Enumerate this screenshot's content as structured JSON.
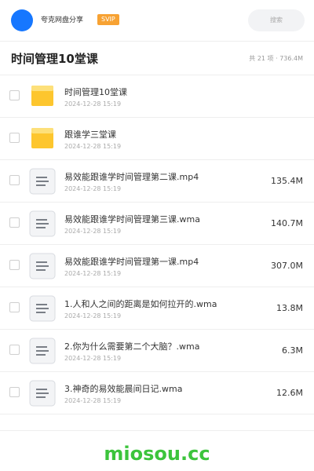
{
  "header": {
    "brand": "夸克网盘分享",
    "vip_badge": "SVIP",
    "search_placeholder": "搜索",
    "avatar_color": "#1677ff"
  },
  "title_bar": {
    "title": "时间管理10堂课",
    "summary": "共 21 项 · 736.4M"
  },
  "files": [
    {
      "name": "时间管理10堂课",
      "date": "2024-12-28 15:19",
      "size": "",
      "type": "folder",
      "icon": "folder-icon"
    },
    {
      "name": "跟谁学三堂课",
      "date": "2024-12-28 15:19",
      "size": "",
      "type": "folder",
      "icon": "folder-icon"
    },
    {
      "name": "易效能跟谁学时间管理第二课.mp4",
      "date": "2024-12-28 15:19",
      "size": "135.4M",
      "type": "file",
      "icon": "file-icon"
    },
    {
      "name": "易效能跟谁学时间管理第三课.wma",
      "date": "2024-12-28 15:19",
      "size": "140.7M",
      "type": "file",
      "icon": "file-icon"
    },
    {
      "name": "易效能跟谁学时间管理第一课.mp4",
      "date": "2024-12-28 15:19",
      "size": "307.0M",
      "type": "file",
      "icon": "file-icon"
    },
    {
      "name": "1.人和人之间的距离是如何拉开的.wma",
      "date": "2024-12-28 15:19",
      "size": "13.8M",
      "type": "file",
      "icon": "file-icon"
    },
    {
      "name": "2.你为什么需要第二个大脑？.wma",
      "date": "2024-12-28 15:19",
      "size": "6.3M",
      "type": "file",
      "icon": "file-icon"
    },
    {
      "name": "3.神奇的易效能晨间日记.wma",
      "date": "2024-12-28 15:19",
      "size": "12.6M",
      "type": "file",
      "icon": "file-icon"
    }
  ],
  "footer": {
    "watermark": "miosou.cc",
    "watermark_color": "#3cc43c"
  },
  "colors": {
    "folder_yellow": "#fdc62e",
    "vip_orange": "#f7a233"
  }
}
